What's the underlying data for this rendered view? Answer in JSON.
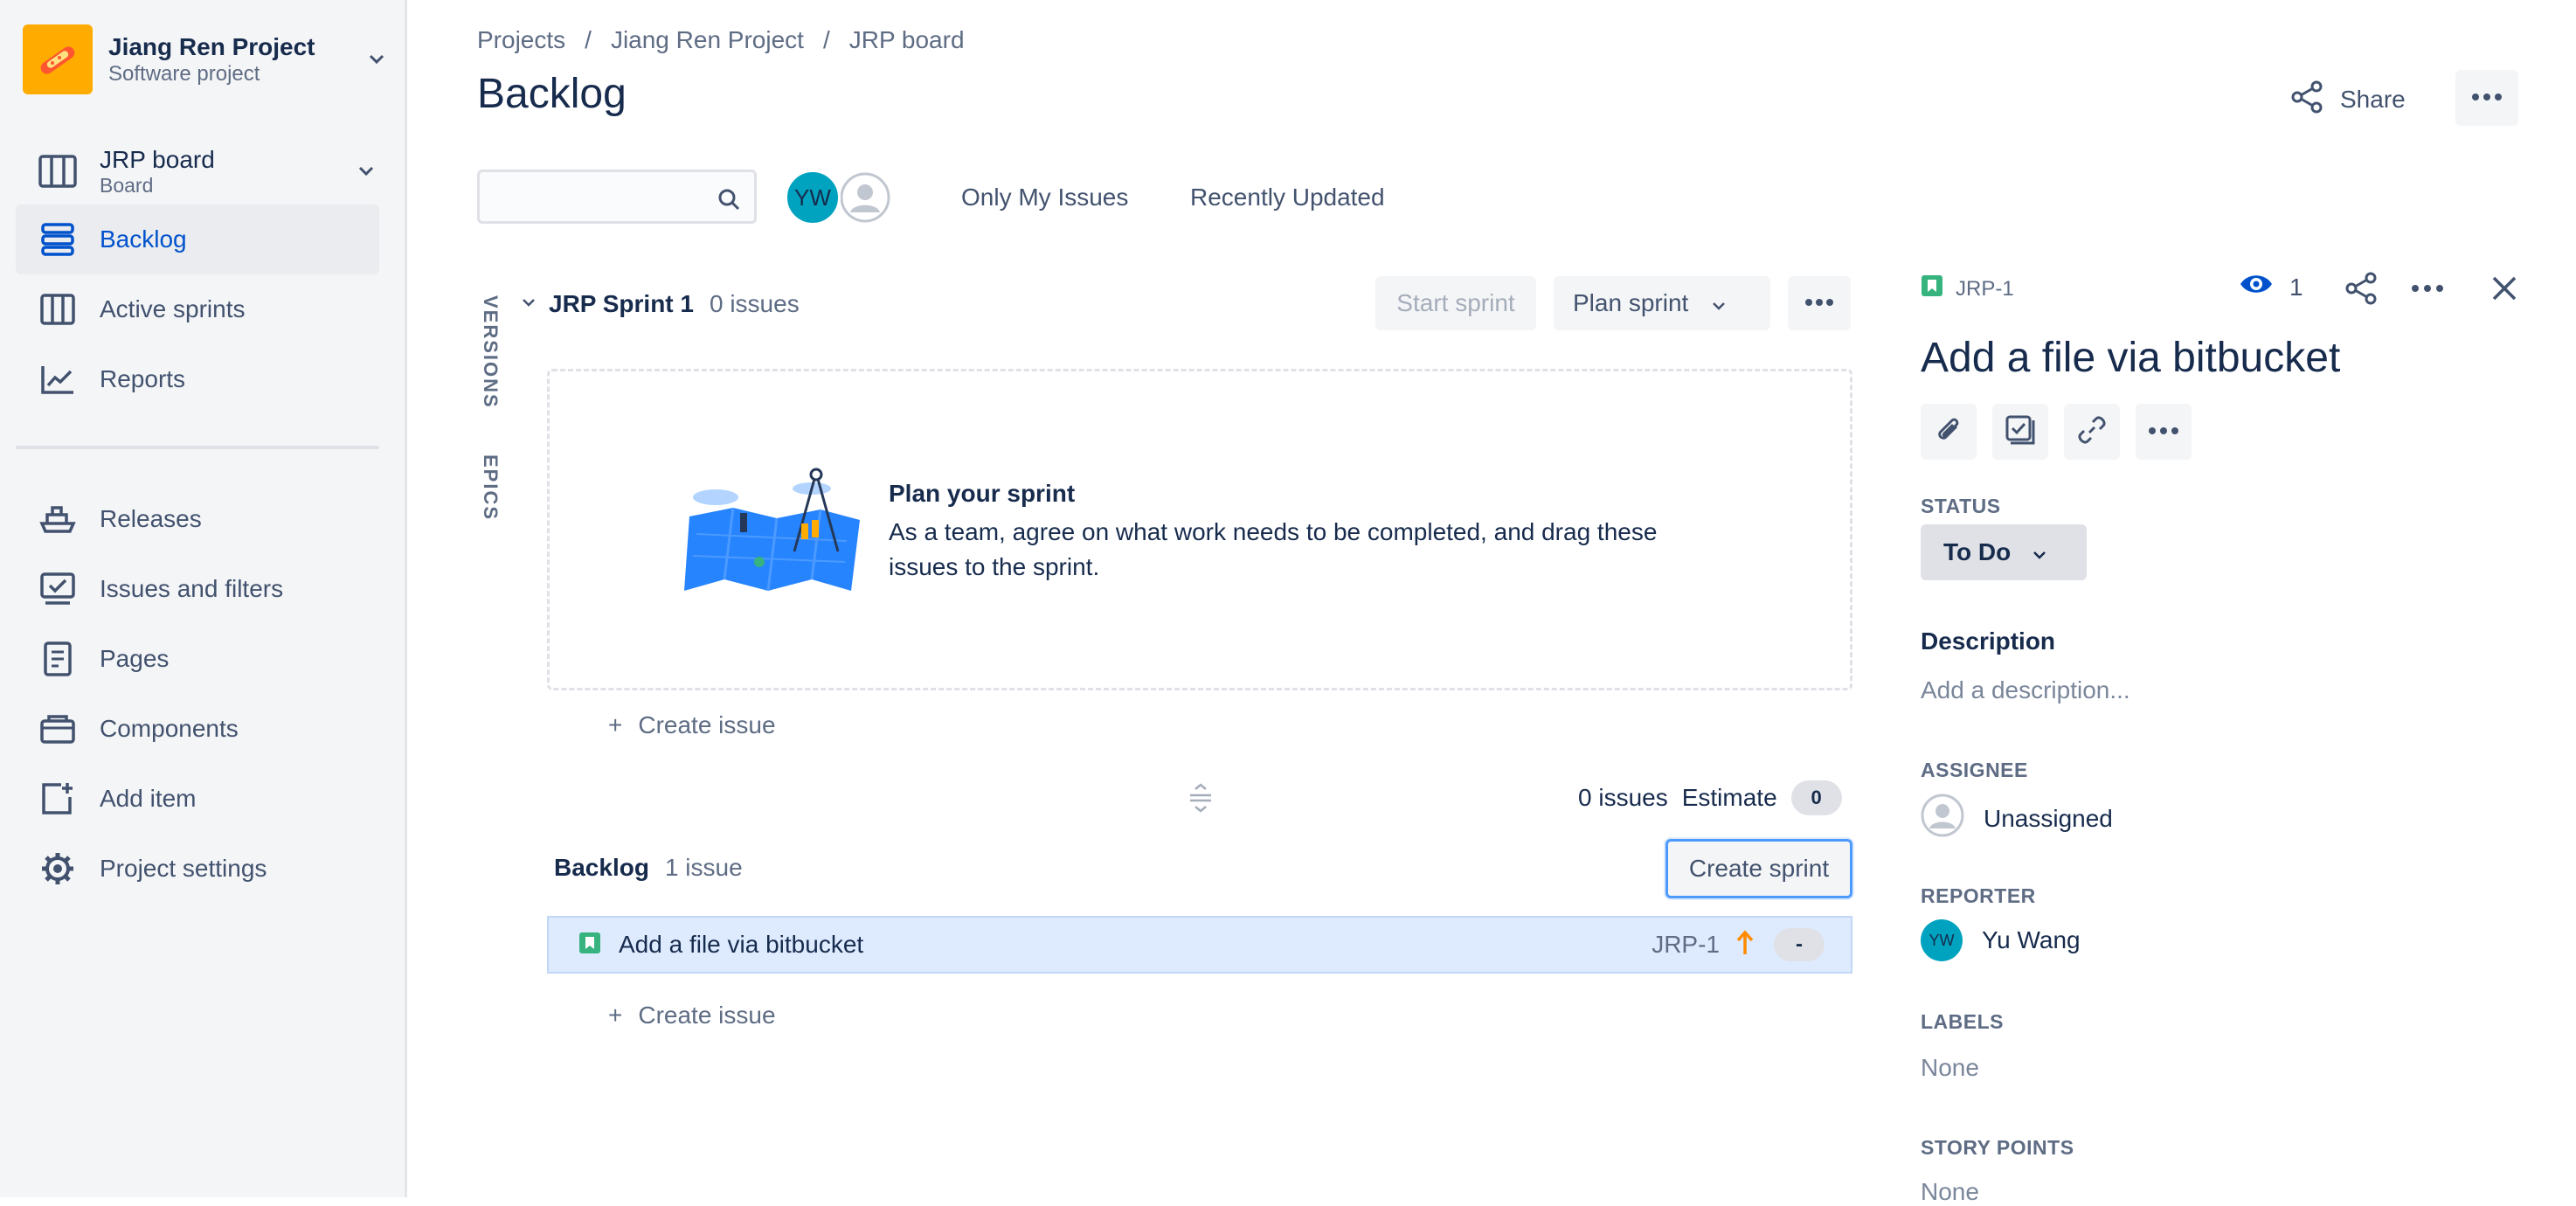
{
  "sidebar": {
    "project_name": "Jiang Ren Project",
    "project_type": "Software project",
    "board_name": "JRP board",
    "board_type": "Board",
    "items": [
      {
        "label": "Backlog",
        "icon": "backlog-icon",
        "active": true
      },
      {
        "label": "Active sprints",
        "icon": "board-columns-icon"
      },
      {
        "label": "Reports",
        "icon": "chart-line-icon"
      },
      {
        "label": "Releases",
        "icon": "ship-icon"
      },
      {
        "label": "Issues and filters",
        "icon": "issues-icon"
      },
      {
        "label": "Pages",
        "icon": "page-icon"
      },
      {
        "label": "Components",
        "icon": "component-icon"
      },
      {
        "label": "Add item",
        "icon": "add-item-icon"
      },
      {
        "label": "Project settings",
        "icon": "gear-icon"
      }
    ]
  },
  "header": {
    "breadcrumbs": [
      "Projects",
      "Jiang Ren Project",
      "JRP board"
    ],
    "title": "Backlog",
    "share_label": "Share"
  },
  "filters": {
    "search_placeholder": "",
    "avatar_initials": "YW",
    "only_my_issues": "Only My Issues",
    "recently_updated": "Recently Updated"
  },
  "side_tabs": {
    "versions": "VERSIONS",
    "epics": "EPICS"
  },
  "sprint": {
    "name": "JRP Sprint 1",
    "count": "0 issues",
    "start_label": "Start sprint",
    "plan_label": "Plan sprint",
    "empty_title": "Plan your sprint",
    "empty_text": "As a team, agree on what work needs to be completed, and drag these issues to the sprint.",
    "create_issue": "Create issue",
    "summary_issues": "0 issues",
    "summary_estimate_label": "Estimate",
    "summary_estimate_value": "0"
  },
  "backlog": {
    "name": "Backlog",
    "count": "1 issue",
    "create_sprint": "Create sprint",
    "issues": [
      {
        "summary": "Add a file via bitbucket",
        "key": "JRP-1",
        "estimate": "-",
        "type": "story",
        "priority": "high"
      }
    ],
    "create_issue": "Create issue"
  },
  "detail": {
    "key": "JRP-1",
    "watchers": "1",
    "title": "Add a file via bitbucket",
    "status_label": "STATUS",
    "status_value": "To Do",
    "description_heading": "Description",
    "description_placeholder": "Add a description...",
    "assignee_label": "ASSIGNEE",
    "assignee_value": "Unassigned",
    "reporter_label": "REPORTER",
    "reporter_value": "Yu Wang",
    "reporter_initials": "YW",
    "labels_label": "LABELS",
    "labels_value": "None",
    "story_points_label": "STORY POINTS",
    "story_points_value": "None"
  },
  "colors": {
    "accent": "#0052CC",
    "story_green": "#36B37E",
    "priority_orange": "#FF8B00",
    "avatar_teal": "#00A3BF",
    "project_avatar": "#FFAB00"
  }
}
